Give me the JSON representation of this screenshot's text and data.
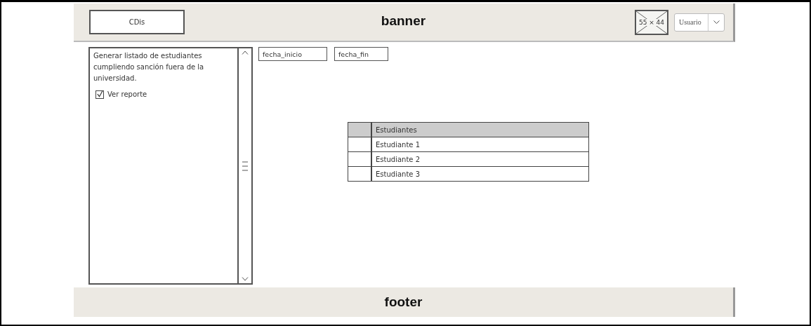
{
  "banner": {
    "logo": "CDis",
    "title": "banner",
    "image_placeholder": "55 × 44",
    "user_select": {
      "value": "Usuario"
    }
  },
  "side_panel": {
    "description": "Generar listado de estudiantes cumpliendo sanción fuera de la universidad.",
    "checkbox": {
      "label": "Ver reporte",
      "checked": true
    }
  },
  "date_fields": [
    {
      "value": "fecha_inicio"
    },
    {
      "value": "fecha_fin"
    }
  ],
  "table": {
    "columns": [
      "",
      "Estudiantes"
    ],
    "rows": [
      [
        "",
        "Estudiante 1"
      ],
      [
        "",
        "Estudiante 2"
      ],
      [
        "",
        "Estudiante 3"
      ]
    ]
  },
  "footer": {
    "title": "footer"
  }
}
